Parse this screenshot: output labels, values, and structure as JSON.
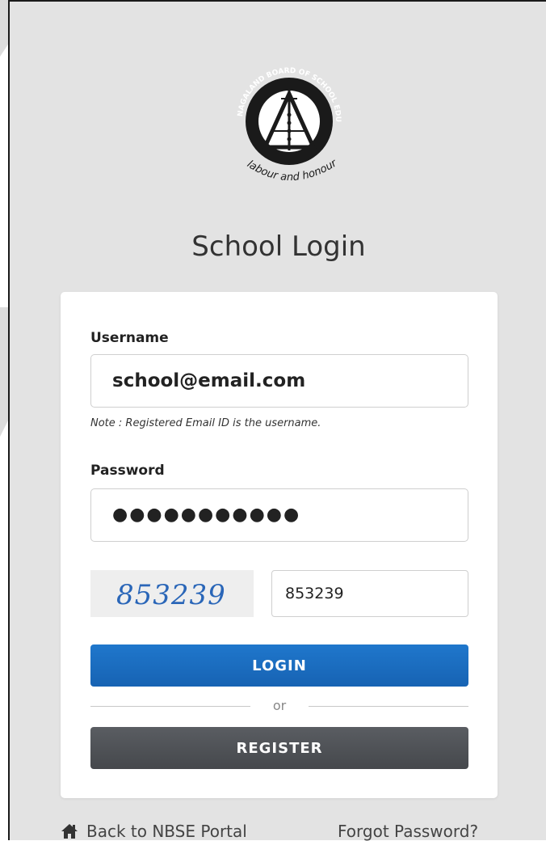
{
  "logo": {
    "top_arc_text": "NAGALAND BOARD OF SCHOOL EDUCATION",
    "motto": "labour and honour"
  },
  "page": {
    "title": "School Login"
  },
  "form": {
    "username_label": "Username",
    "username_value": "school@email.com",
    "note": "Note : Registered Email ID is the username.",
    "password_label": "Password",
    "password_dots": "●●●●●●●●●●●",
    "captcha_image_text": "853239",
    "captcha_value": "853239",
    "login_label": "LOGIN",
    "or_text": "or",
    "register_label": "REGISTER"
  },
  "footer": {
    "back_link": "Back to NBSE Portal",
    "forgot_link": "Forgot Password?"
  },
  "colors": {
    "login_button": "#1763b3",
    "register_button": "#45484c",
    "panel_bg": "#e3e3e3"
  },
  "icons": {
    "home": "home-icon",
    "logo": "nbse-logo"
  }
}
